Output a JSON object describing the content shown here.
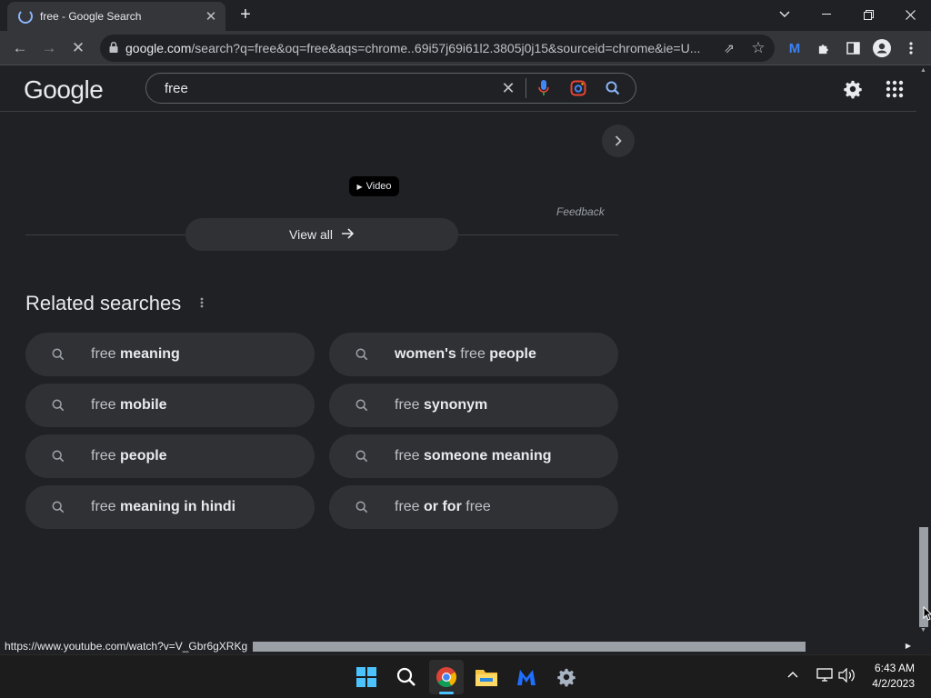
{
  "browser": {
    "tab_title": "free - Google Search",
    "url_host": "google.com",
    "url_rest": "/search?q=free&oq=free&aqs=chrome..69i57j69i61l2.3805j0j15&sourceid=chrome&ie=U..."
  },
  "google": {
    "logo": "Google",
    "query": "free"
  },
  "results": {
    "video_badge": "Video",
    "feedback": "Feedback",
    "view_all": "View all"
  },
  "related": {
    "heading": "Related searches",
    "items": [
      {
        "pre": "free ",
        "bold": "meaning",
        "post": ""
      },
      {
        "pre": "",
        "bold": "women's",
        "post": " free people",
        "post_bold": "people",
        "mid": " free "
      },
      {
        "pre": "free ",
        "bold": "mobile",
        "post": ""
      },
      {
        "pre": "free ",
        "bold": "synonym",
        "post": ""
      },
      {
        "pre": "free ",
        "bold": "people",
        "post": ""
      },
      {
        "pre": "free ",
        "bold": "someone meaning",
        "post": ""
      },
      {
        "pre": "free ",
        "bold": "meaning in hindi",
        "post": ""
      },
      {
        "pre": "free ",
        "bold": "or for",
        "post": " free"
      }
    ]
  },
  "status_url": "https://www.youtube.com/watch?v=V_Gbr6gXRKg",
  "clock": {
    "time": "6:43 AM",
    "date": "4/2/2023"
  },
  "colors": {
    "accent": "#8ab4f8",
    "bg": "#202124",
    "chip": "#303134"
  }
}
